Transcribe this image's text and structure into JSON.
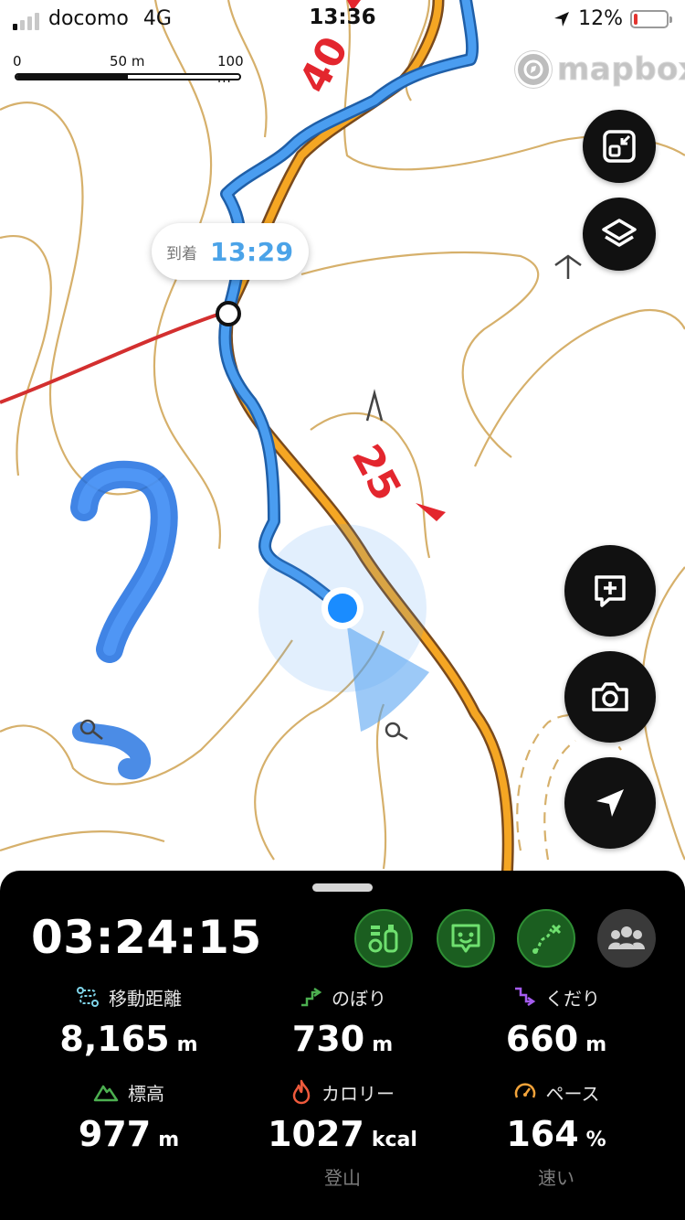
{
  "status_bar": {
    "carrier": "docomo",
    "network": "4G",
    "time": "13:36",
    "battery": "12%",
    "battery_level": 0.12
  },
  "map": {
    "scale": {
      "zero": "0",
      "mid": "50 m",
      "max": "100 m"
    },
    "attribution": "mapbox",
    "arrival_callout": {
      "label": "到着",
      "time": "13:29"
    },
    "labels": {
      "top_number": "40",
      "mid_number": "25"
    },
    "buttons": {
      "fit_route": "fit-route-icon",
      "layers": "layers-icon",
      "add_memo": "add-memo-icon",
      "camera": "camera-icon",
      "locate": "locate-icon"
    }
  },
  "panel": {
    "elapsed_time": "03:24:15",
    "actions": [
      "checkpoint-icon",
      "status-icon",
      "route-reset-icon",
      "group-icon"
    ],
    "stats": {
      "distance": {
        "label": "移動距離",
        "value": "8,165",
        "unit": "m"
      },
      "ascent": {
        "label": "のぼり",
        "value": "730",
        "unit": "m"
      },
      "descent": {
        "label": "くだり",
        "value": "660",
        "unit": "m"
      },
      "altitude": {
        "label": "標高",
        "value": "977",
        "unit": "m"
      },
      "calories": {
        "label": "カロリー",
        "value": "1027",
        "unit": "kcal",
        "note": "登山"
      },
      "pace": {
        "label": "ペース",
        "value": "164",
        "unit": "%",
        "note": "速い"
      }
    }
  },
  "colors": {
    "contour": "#d6b06b",
    "trail_orange": "#f5a623",
    "track_blue": "#3b8fe6",
    "road_red": "#d32f2f",
    "accent_green": "#2f8f35"
  }
}
